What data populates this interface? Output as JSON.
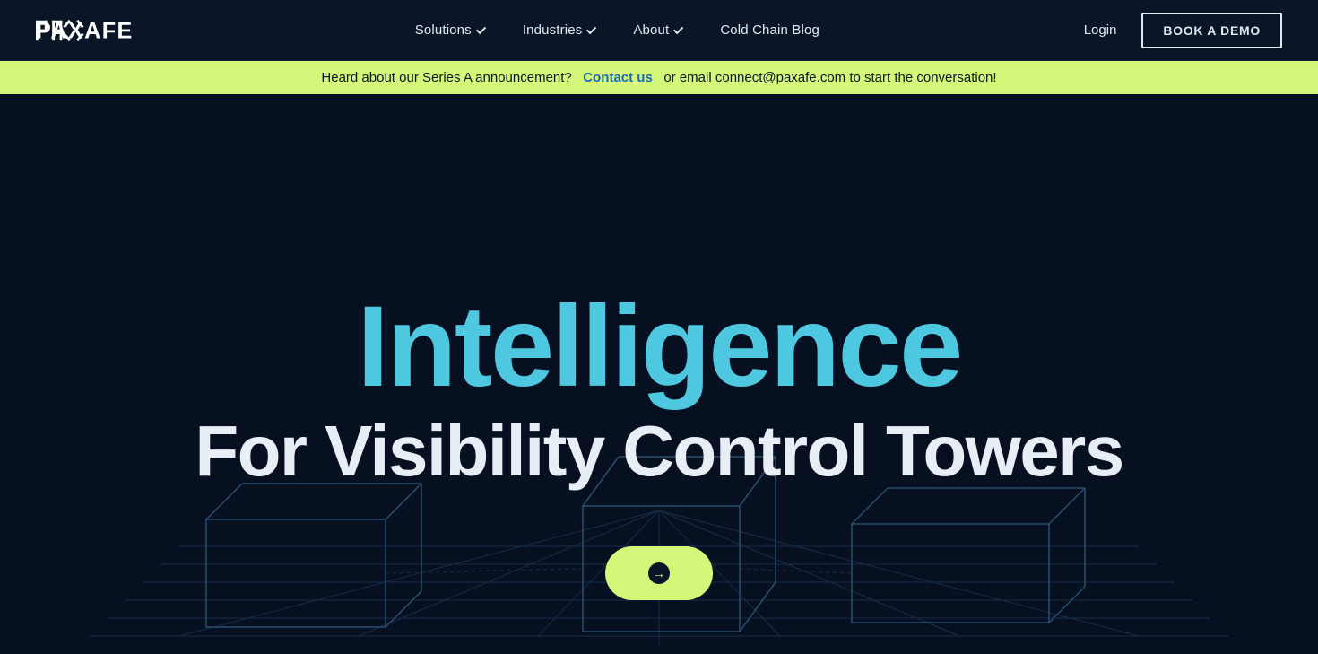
{
  "nav": {
    "logo_alt": "PAXAFE",
    "links": [
      {
        "label": "Solutions",
        "has_dropdown": true
      },
      {
        "label": "Industries",
        "has_dropdown": true
      },
      {
        "label": "About",
        "has_dropdown": true
      },
      {
        "label": "Cold Chain Blog",
        "has_dropdown": false
      }
    ],
    "login_label": "Login",
    "book_demo_label": "BOOK A DEMO"
  },
  "banner": {
    "text_before": "Heard about our Series A announcement?",
    "link_label": "Contact us",
    "text_after": "or email connect@paxafe.com to start the conversation!",
    "link_href": "#"
  },
  "hero": {
    "line1": "Intelligence",
    "line2": "For Visibility Control Towers"
  },
  "cta": {
    "label": ""
  }
}
